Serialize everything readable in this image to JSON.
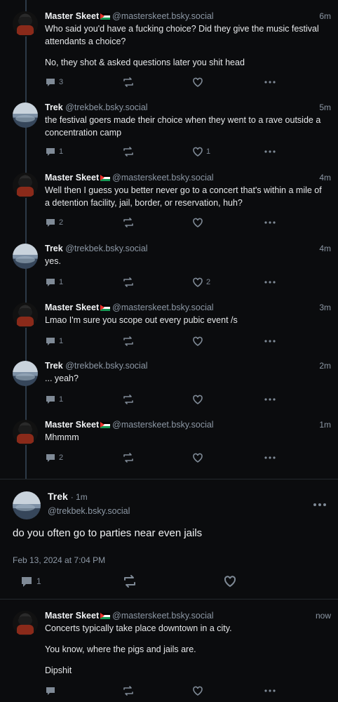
{
  "colors": {
    "background": "#0b0c0e",
    "thread_line": "#2d3a47",
    "muted": "#8d98a5"
  },
  "posts": [
    {
      "author": "Master Skeet",
      "handle": "@masterskeet.bsky.social",
      "time": "6m",
      "paragraphs": [
        "Who said you'd have a fucking choice? Did they give the music festival attendants a choice?",
        "No, they shot & asked questions later you shit head"
      ],
      "replies": "3",
      "reposts": "",
      "likes": ""
    },
    {
      "author": "Trek",
      "handle": "@trekbek.bsky.social",
      "time": "5m",
      "paragraphs": [
        "the festival goers made their choice when they went to a rave outside a concentration camp"
      ],
      "replies": "1",
      "reposts": "",
      "likes": "1"
    },
    {
      "author": "Master Skeet",
      "handle": "@masterskeet.bsky.social",
      "time": "4m",
      "paragraphs": [
        "Well then I guess you better never go to a concert that's within a mile of a detention facility, jail, border, or reservation, huh?"
      ],
      "replies": "2",
      "reposts": "",
      "likes": ""
    },
    {
      "author": "Trek",
      "handle": "@trekbek.bsky.social",
      "time": "4m",
      "paragraphs": [
        "yes."
      ],
      "replies": "1",
      "reposts": "",
      "likes": "2"
    },
    {
      "author": "Master Skeet",
      "handle": "@masterskeet.bsky.social",
      "time": "3m",
      "paragraphs": [
        "Lmao I'm sure you scope out every pubic event /s"
      ],
      "replies": "1",
      "reposts": "",
      "likes": ""
    },
    {
      "author": "Trek",
      "handle": "@trekbek.bsky.social",
      "time": "2m",
      "paragraphs": [
        "... yeah?"
      ],
      "replies": "1",
      "reposts": "",
      "likes": ""
    },
    {
      "author": "Master Skeet",
      "handle": "@masterskeet.bsky.social",
      "time": "1m",
      "paragraphs": [
        "Mhmmm"
      ],
      "replies": "2",
      "reposts": "",
      "likes": ""
    }
  ],
  "focus": {
    "author": "Trek",
    "time": "1m",
    "handle": "@trekbek.bsky.social",
    "text": "do you often go to parties near even jails",
    "date": "Feb 13, 2024 at 7:04 PM",
    "replies": "1"
  },
  "reply": {
    "author": "Master Skeet",
    "handle": "@masterskeet.bsky.social",
    "time": "now",
    "paragraphs": [
      "Concerts typically take place downtown in a city.",
      "You know, where the pigs and jails are.",
      "Dipshit"
    ]
  }
}
